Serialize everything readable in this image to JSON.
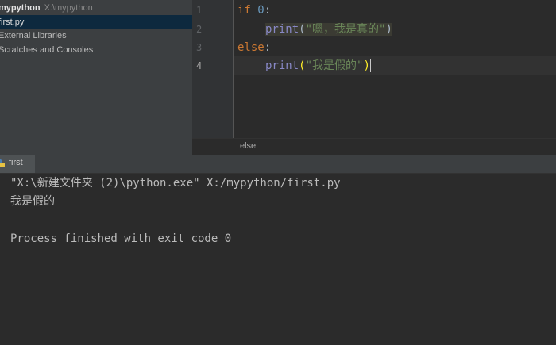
{
  "project_tree": {
    "root_name": "mypython",
    "root_path": "X:\\mypython",
    "items": [
      {
        "label": "first.py"
      },
      {
        "label": "External Libraries"
      },
      {
        "label": "Scratches and Consoles"
      }
    ]
  },
  "editor": {
    "line_numbers": [
      "1",
      "2",
      "3",
      "4"
    ],
    "current_line": "4",
    "line1": {
      "keyword": "if",
      "number": "0",
      "colon": ":"
    },
    "line2": {
      "func": "print",
      "open": "(",
      "string": "\"嗯，我是真的\"",
      "close": ")"
    },
    "line3": {
      "keyword": "else",
      "colon": ":"
    },
    "line4": {
      "func": "print",
      "open": "(",
      "string": "\"我是假的\"",
      "close": ")"
    },
    "breadcrumb": "else"
  },
  "run_panel": {
    "tab_label": "first",
    "tab_icon": "python-icon",
    "output_lines": [
      "\"X:\\新建文件夹 (2)\\python.exe\" X:/mypython/first.py",
      "我是假的",
      "",
      "Process finished with exit code 0"
    ]
  },
  "colors": {
    "keyword": "#cc7832",
    "number": "#6897bb",
    "builtin": "#8888c6",
    "string": "#6a8759",
    "selection": "#0d293e",
    "brace_match": "#ffef28"
  }
}
